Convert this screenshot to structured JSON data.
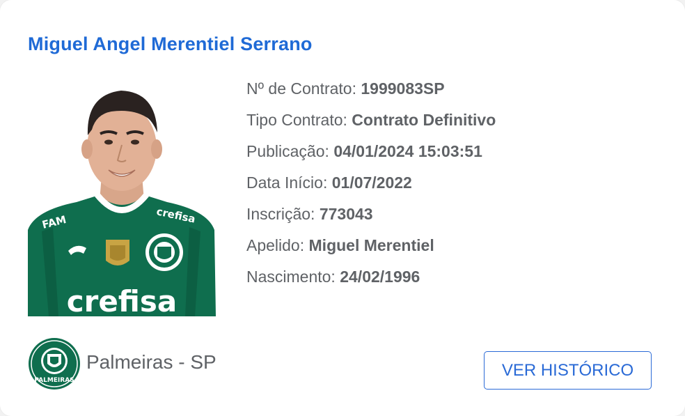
{
  "player": {
    "name": "Miguel Angel Merentiel Serrano"
  },
  "details": [
    {
      "label": "Nº de Contrato: ",
      "value": "1999083SP"
    },
    {
      "label": "Tipo Contrato: ",
      "value": "Contrato Definitivo"
    },
    {
      "label": "Publicação: ",
      "value": "04/01/2024 15:03:51"
    },
    {
      "label": "Data Início: ",
      "value": "01/07/2022"
    },
    {
      "label": "Inscrição: ",
      "value": "773043"
    },
    {
      "label": "Apelido: ",
      "value": "Miguel Merentiel"
    },
    {
      "label": "Nascimento: ",
      "value": "24/02/1996"
    }
  ],
  "club": {
    "name": "Palmeiras - SP",
    "logo_icon": "palmeiras-crest-icon",
    "logo_text": "PALMEIRAS"
  },
  "jersey": {
    "sponsor": "crefisa",
    "collar_sponsor": "FAM",
    "shoulder_sponsor": "crefisa"
  },
  "actions": {
    "history_label": "VER HISTÓRICO"
  },
  "colors": {
    "accent": "#1f6ad6",
    "text": "#5f6266",
    "jersey_green": "#0f6e4e"
  }
}
